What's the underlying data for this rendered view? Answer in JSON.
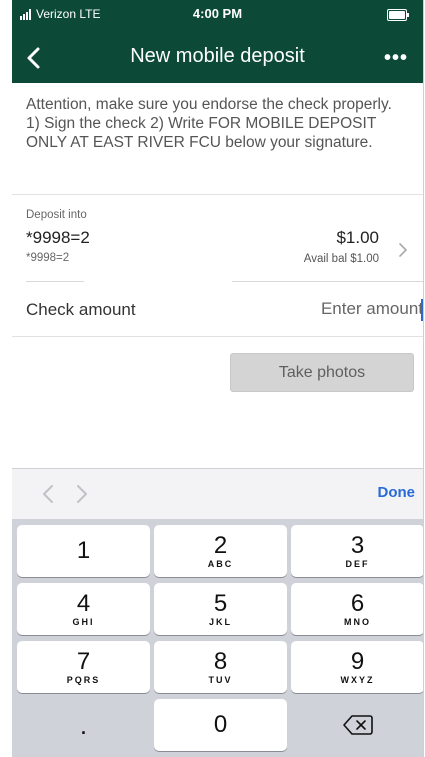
{
  "status_bar": {
    "carrier": "Verizon  LTE",
    "time": "4:00 PM"
  },
  "nav": {
    "title": "New mobile deposit",
    "more": "•••"
  },
  "attention": {
    "text": "Attention, make sure you endorse the check properly. 1) Sign the check 2) Write FOR MOBILE DEPOSIT ONLY AT EAST RIVER FCU below your signature."
  },
  "deposit": {
    "label": "Deposit into",
    "account": "*9998=2",
    "account_sub": "*9998=2",
    "amount": "$1.00",
    "available": "Avail bal $1.00"
  },
  "check_amount": {
    "label": "Check amount",
    "placeholder": "Enter amount"
  },
  "take_photos": {
    "label": "Take photos"
  },
  "accessory": {
    "done": "Done"
  },
  "keypad": {
    "keys": [
      {
        "num": "1",
        "letters": ""
      },
      {
        "num": "2",
        "letters": "ABC"
      },
      {
        "num": "3",
        "letters": "DEF"
      },
      {
        "num": "4",
        "letters": "GHI"
      },
      {
        "num": "5",
        "letters": "JKL"
      },
      {
        "num": "6",
        "letters": "MNO"
      },
      {
        "num": "7",
        "letters": "PQRS"
      },
      {
        "num": "8",
        "letters": "TUV"
      },
      {
        "num": "9",
        "letters": "WXYZ"
      },
      {
        "num": "0",
        "letters": ""
      }
    ],
    "decimal": "."
  },
  "colors": {
    "header": "#0c4a37",
    "accent": "#2a6ad6",
    "keyboard_bg": "#cfd3d9"
  }
}
